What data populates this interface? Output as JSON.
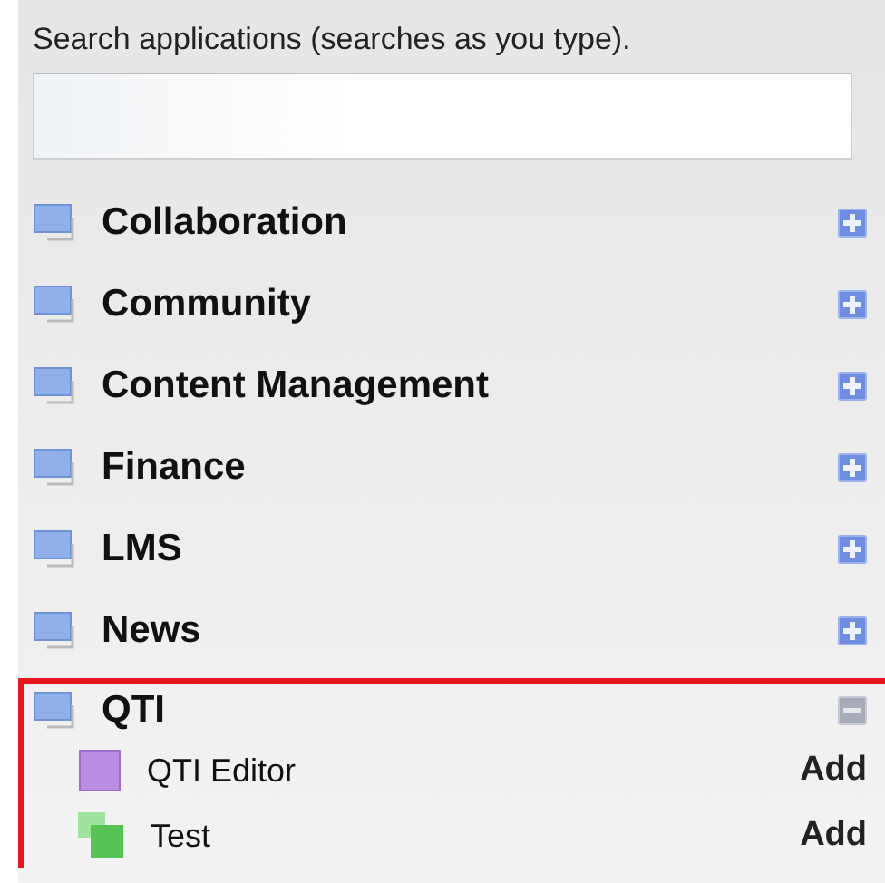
{
  "search": {
    "label": "Search applications (searches as you type)."
  },
  "categories": [
    {
      "name": "Collaboration",
      "expanded": false,
      "highlighted": false
    },
    {
      "name": "Community",
      "expanded": false,
      "highlighted": false
    },
    {
      "name": "Content Management",
      "expanded": false,
      "highlighted": false
    },
    {
      "name": "Finance",
      "expanded": false,
      "highlighted": false
    },
    {
      "name": "LMS",
      "expanded": false,
      "highlighted": false
    },
    {
      "name": "News",
      "expanded": false,
      "highlighted": false
    },
    {
      "name": "QTI",
      "expanded": true,
      "highlighted": true,
      "children": [
        {
          "name": "QTI Editor",
          "kind": "single",
          "color": "#b98ee2",
          "action": "Add"
        },
        {
          "name": "Test",
          "kind": "stacked",
          "color": "#55c455",
          "action": "Add"
        }
      ]
    }
  ]
}
